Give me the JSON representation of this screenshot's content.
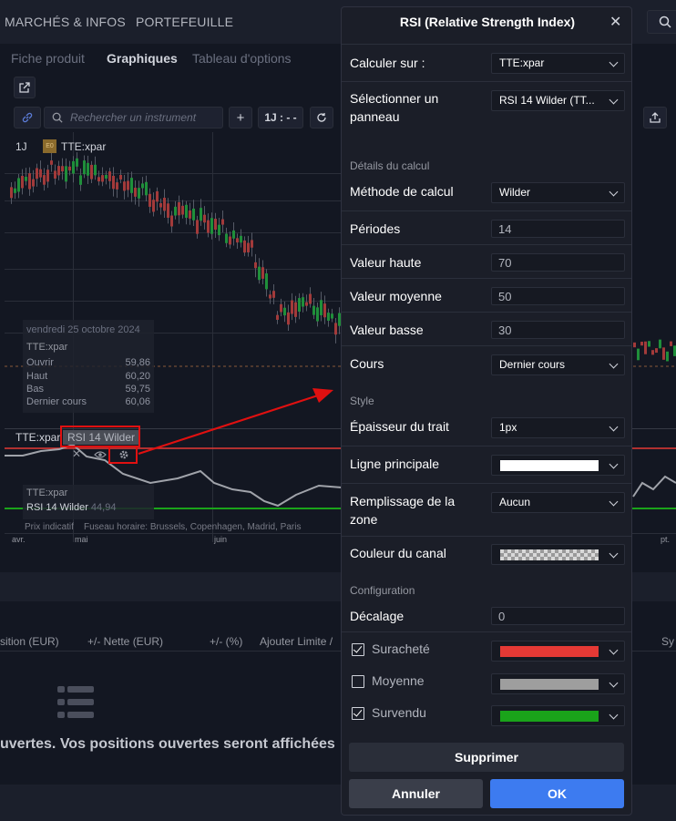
{
  "topnav": {
    "item1": "MARCHÉS & INFOS",
    "item2": "PORTEFEUILLE"
  },
  "tabs": [
    "Fiche produit",
    "Graphiques",
    "Tableau d'options"
  ],
  "toolbar": {
    "search_placeholder": "Rechercher un instrument",
    "add": "+",
    "interval": "1J : - -"
  },
  "chart": {
    "interval_label": "1J",
    "badge": "E0",
    "symbol": "TTE:xpar",
    "info": {
      "date": "vendredi 25 octobre 2024",
      "symbol": "TTE:xpar",
      "rows": [
        {
          "label": "Ouvrir",
          "value": "59,86"
        },
        {
          "label": "Haut",
          "value": "60,20"
        },
        {
          "label": "Bas",
          "value": "59,75"
        },
        {
          "label": "Dernier cours",
          "value": "60,06"
        }
      ]
    },
    "rsi_pane_symbol": "TTE:xpar",
    "rsi_label": "RSI 14 Wilder",
    "rsi_info": {
      "symbol": "TTE:xpar",
      "label": "RSI 14 Wilder",
      "value": "44,94"
    },
    "footer": {
      "prix": "Prix indicatif",
      "timezone": "Fuseau horaire: Brussels, Copenhagen, Madrid, Paris"
    },
    "x_ticks": [
      "avr.",
      "mai",
      "juin",
      "pt."
    ]
  },
  "positions": {
    "headers": [
      "sition (EUR)",
      "+/- Nette (EUR)",
      "+/- (%)",
      "Ajouter Limite /",
      "Sy"
    ],
    "empty_text": "uvertes. Vos positions ouvertes seront affichées"
  },
  "modal": {
    "title": "RSI (Relative Strength Index)",
    "calc_on_label": "Calculer sur :",
    "calc_on_value": "TTE:xpar",
    "panel_label": "Sélectionner un panneau",
    "panel_value": "RSI 14 Wilder (TT...",
    "section_calc": "Détails du calcul",
    "method_label": "Méthode de calcul",
    "method_value": "Wilder",
    "periods_label": "Périodes",
    "periods_value": "14",
    "high_label": "Valeur haute",
    "high_value": "70",
    "mid_label": "Valeur moyenne",
    "mid_value": "50",
    "low_label": "Valeur basse",
    "low_value": "30",
    "price_label": "Cours",
    "price_value": "Dernier cours",
    "section_style": "Style",
    "thickness_label": "Épaisseur du trait",
    "thickness_value": "1px",
    "main_line_label": "Ligne principale",
    "fill_label": "Remplissage de la zone",
    "fill_value": "Aucun",
    "channel_label": "Couleur du canal",
    "section_config": "Configuration",
    "offset_label": "Décalage",
    "offset_value": "0",
    "overbought_label": "Suracheté",
    "average_label": "Moyenne",
    "oversold_label": "Survendu",
    "delete_label": "Supprimer",
    "cancel_label": "Annuler",
    "ok_label": "OK",
    "colors": {
      "main_line": "#ffffff",
      "overbought": "#e53935",
      "average": "#9e9e9e",
      "oversold": "#1aa31a"
    }
  }
}
